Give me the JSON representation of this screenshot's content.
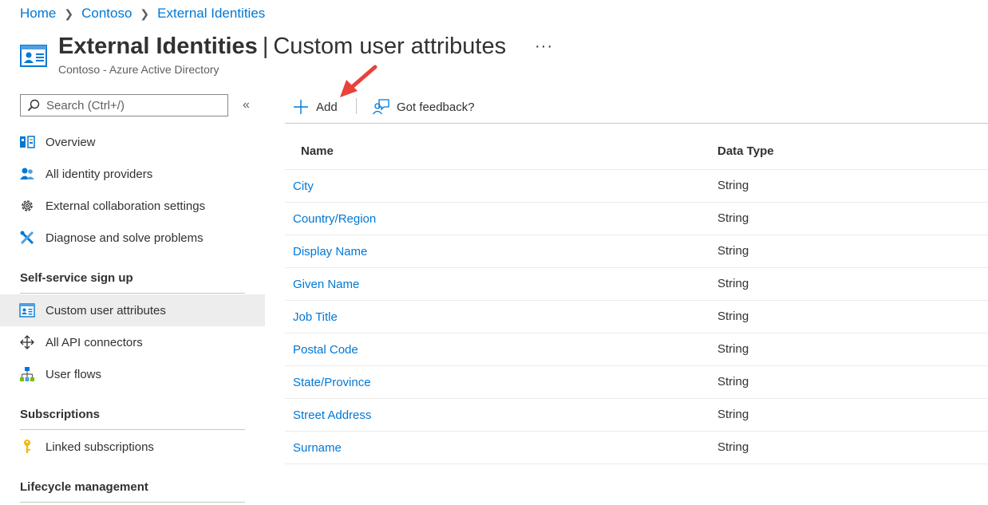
{
  "breadcrumb": {
    "items": [
      "Home",
      "Contoso",
      "External Identities"
    ]
  },
  "header": {
    "title_strong": "External Identities",
    "title_sep": "|",
    "title_rest": "Custom user attributes",
    "more": "···",
    "subtitle": "Contoso - Azure Active Directory"
  },
  "search": {
    "placeholder": "Search (Ctrl+/)"
  },
  "collapse": "«",
  "nav": {
    "items": [
      {
        "label": "Overview",
        "icon": "overview-icon"
      },
      {
        "label": "All identity providers",
        "icon": "identity-providers-icon"
      },
      {
        "label": "External collaboration settings",
        "icon": "gear-icon"
      },
      {
        "label": "Diagnose and solve problems",
        "icon": "wrench-icon"
      }
    ],
    "sections": [
      {
        "title": "Self-service sign up",
        "items": [
          {
            "label": "Custom user attributes",
            "icon": "user-card-icon",
            "selected": true
          },
          {
            "label": "All API connectors",
            "icon": "move-arrows-icon"
          },
          {
            "label": "User flows",
            "icon": "user-flows-icon"
          }
        ]
      },
      {
        "title": "Subscriptions",
        "items": [
          {
            "label": "Linked subscriptions",
            "icon": "key-icon"
          }
        ]
      },
      {
        "title": "Lifecycle management",
        "items": []
      }
    ]
  },
  "toolbar": {
    "add_label": "Add",
    "feedback_label": "Got feedback?"
  },
  "table": {
    "columns": [
      "Name",
      "Data Type"
    ],
    "rows": [
      {
        "name": "City",
        "type": "String"
      },
      {
        "name": "Country/Region",
        "type": "String"
      },
      {
        "name": "Display Name",
        "type": "String"
      },
      {
        "name": "Given Name",
        "type": "String"
      },
      {
        "name": "Job Title",
        "type": "String"
      },
      {
        "name": "Postal Code",
        "type": "String"
      },
      {
        "name": "State/Province",
        "type": "String"
      },
      {
        "name": "Street Address",
        "type": "String"
      },
      {
        "name": "Surname",
        "type": "String"
      }
    ]
  },
  "colors": {
    "link": "#0078d4",
    "text": "#323130",
    "selected_bg": "#ededed",
    "annotation_arrow": "#e8433b"
  }
}
